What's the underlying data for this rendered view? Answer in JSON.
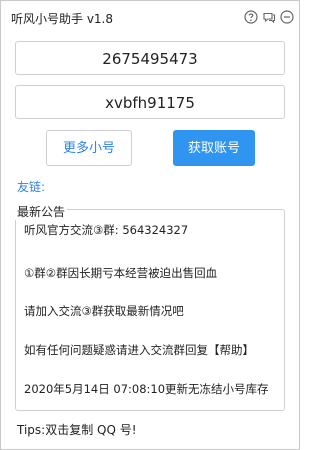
{
  "app": {
    "title": "听风小号助手  v1.8"
  },
  "titlebar_icons": [
    "help-icon",
    "chat-icon",
    "minimize-icon"
  ],
  "account": {
    "qq_number": "2675495473",
    "password": "xvbfh91175"
  },
  "buttons": {
    "more_label": "更多小号",
    "get_label": "获取账号"
  },
  "friend_links": {
    "label": "友链:"
  },
  "notice": {
    "title": "最新公告",
    "lines": [
      "听风官方交流③群: 564324327",
      "①群②群因长期亏本经营被迫出售回血",
      "请加入交流③群获取最新情况吧",
      "如有任何问题疑惑请进入交流群回复【帮助】",
      "2020年5月14日 07:08:10更新无冻结小号库存"
    ]
  },
  "tips": {
    "text": "Tips:双击复制 QQ 号!"
  },
  "colors": {
    "accent": "#2f95f0",
    "link": "#2f80ed",
    "border": "#cfcfcf"
  }
}
